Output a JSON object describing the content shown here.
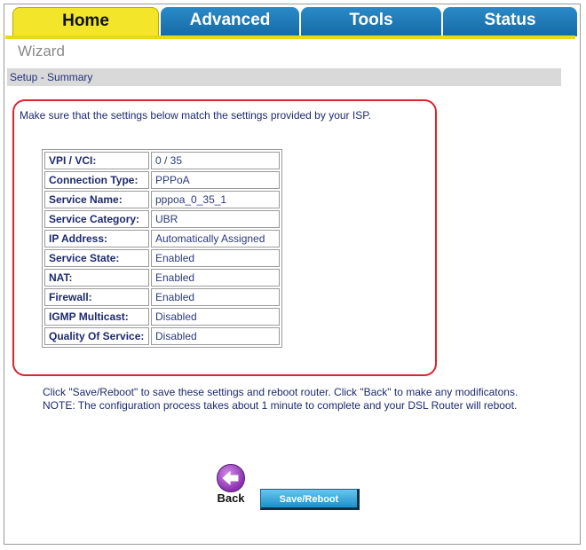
{
  "tabs": [
    {
      "label": "Home"
    },
    {
      "label": "Advanced"
    },
    {
      "label": "Tools"
    },
    {
      "label": "Status"
    }
  ],
  "page_title": "Wizard",
  "breadcrumb": "Setup - Summary",
  "intro": "Make sure that the settings below match the settings provided by your ISP.",
  "summary": [
    {
      "label": "VPI / VCI:",
      "value": "0 / 35"
    },
    {
      "label": "Connection Type:",
      "value": "PPPoA"
    },
    {
      "label": "Service Name:",
      "value": "pppoa_0_35_1"
    },
    {
      "label": "Service Category:",
      "value": "UBR"
    },
    {
      "label": "IP Address:",
      "value": "Automatically Assigned"
    },
    {
      "label": "Service State:",
      "value": "Enabled"
    },
    {
      "label": "NAT:",
      "value": "Enabled"
    },
    {
      "label": "Firewall:",
      "value": "Enabled"
    },
    {
      "label": "IGMP Multicast:",
      "value": "Disabled"
    },
    {
      "label": "Quality Of Service:",
      "value": "Disabled"
    }
  ],
  "note_line1": "Click \"Save/Reboot\" to save these settings and reboot router. Click \"Back\" to make any modificatons.",
  "note_line2": "NOTE: The configuration process takes about 1 minute to complete and your DSL Router will reboot.",
  "buttons": {
    "back": "Back",
    "save": "Save/Reboot"
  },
  "colors": {
    "active_tab": "#f2e52a",
    "tab": "#1f7bbb",
    "highlight_border": "#d6262f",
    "back_button": "#8a2fb0",
    "save_button": "#2a9fd6"
  },
  "icons": {
    "back": "back-arrow-icon"
  }
}
